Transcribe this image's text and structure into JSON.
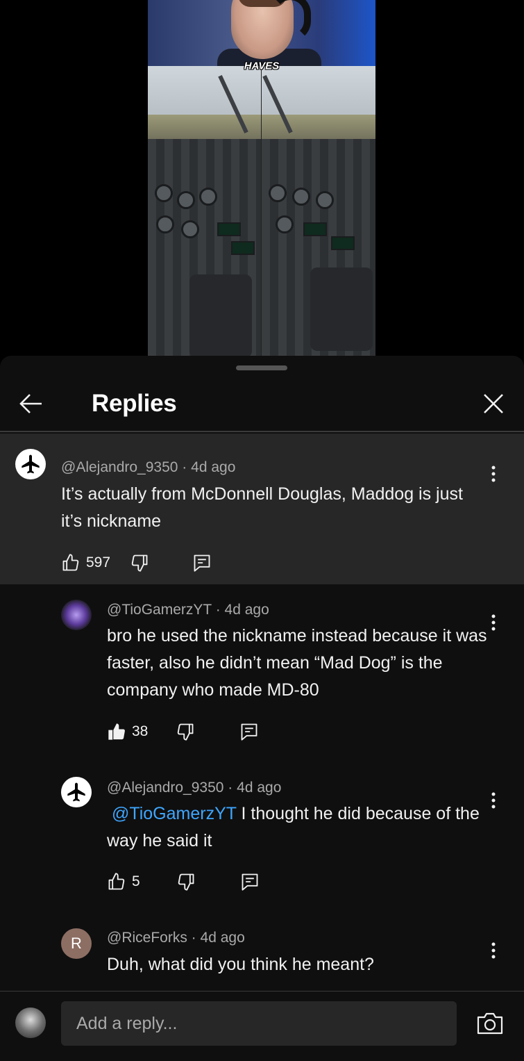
{
  "video": {
    "caption": "HAVES"
  },
  "header": {
    "title": "Replies"
  },
  "comments": [
    {
      "handle": "@Alejandro_9350",
      "time": "4d ago",
      "text": "It’s actually from McDonnell Douglas, Maddog is just it’s nickname",
      "likes": "597",
      "liked": false,
      "avatar": "airplane-icon"
    },
    {
      "handle": "@TioGamerzYT",
      "time": "4d ago",
      "text": "bro he used the nickname instead because it was faster, also he didn’t mean “Mad Dog” is the company who made MD-80",
      "likes": "38",
      "liked": true,
      "avatar": "purple-image"
    },
    {
      "handle": "@Alejandro_9350",
      "time": "4d ago",
      "mention": "@TioGamerzYT",
      "text": " I thought he did because of the way he said it",
      "likes": "5",
      "liked": false,
      "avatar": "airplane-icon"
    },
    {
      "handle": "@RiceForks",
      "time": "4d ago",
      "text": "Duh, what did you think he meant?",
      "avatar_letter": "R"
    }
  ],
  "separator": "·",
  "reply_bar": {
    "placeholder": "Add a reply..."
  },
  "colors": {
    "background": "#0f0f0f",
    "highlight": "#272727",
    "mention": "#3ea6ff",
    "meta_text": "#aaaaaa"
  }
}
